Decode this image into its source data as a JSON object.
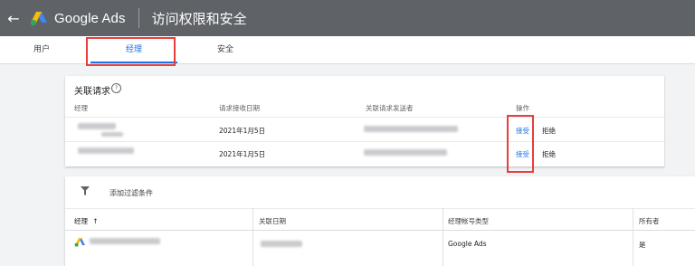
{
  "topbar": {
    "brand": "Google Ads",
    "title": "访问权限和安全",
    "back_icon": "arrow-back-icon",
    "logo": "google-ads-logo"
  },
  "tabs": [
    {
      "label": "用户"
    },
    {
      "label": "经理",
      "active": true
    },
    {
      "label": "安全"
    }
  ],
  "requests": {
    "title": "关联请求",
    "headers": {
      "manager": "经理",
      "received_date": "请求接收日期",
      "sender": "关联请求发送者",
      "action": "操作"
    },
    "rows": [
      {
        "date": "2021年1月5日",
        "accept": "接受",
        "reject": "拒绝"
      },
      {
        "date": "2021年1月5日",
        "accept": "接受",
        "reject": "拒绝"
      }
    ]
  },
  "managers_table": {
    "filter_label": "添加过滤条件",
    "headers": {
      "manager": "经理",
      "sort_icon": "↑",
      "linked_date": "关联日期",
      "account_type": "经理帐号类型",
      "owner": "所有者"
    },
    "rows": [
      {
        "account_type": "Google Ads",
        "owner": "是"
      }
    ]
  },
  "colors": {
    "topbar": "#5f6368",
    "accent": "#1a73e8",
    "highlight": "#ea3d3d"
  }
}
